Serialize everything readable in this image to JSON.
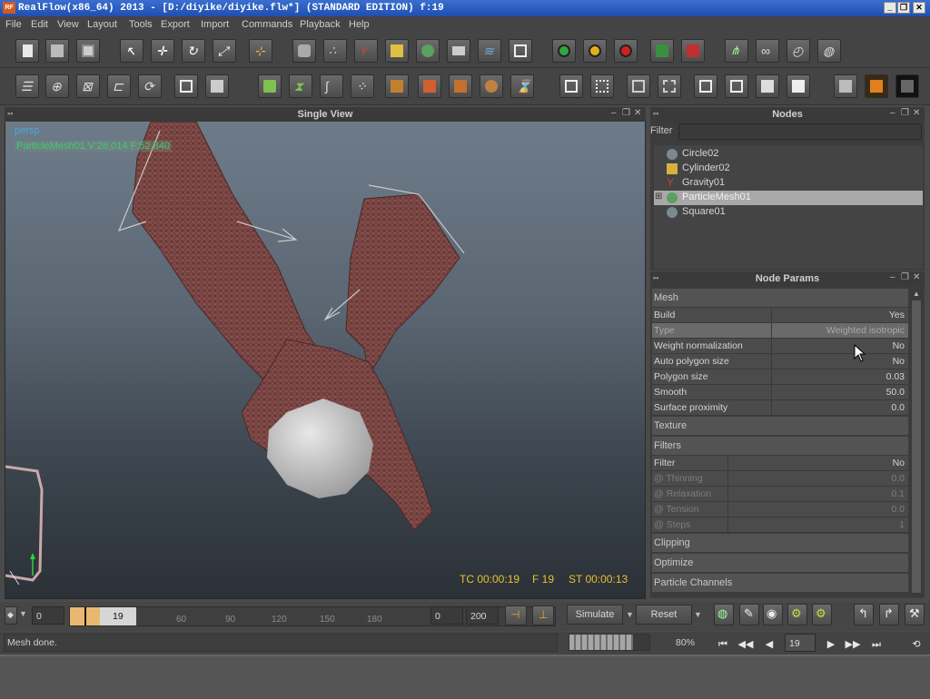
{
  "window": {
    "app_icon_text": "RF",
    "title": "RealFlow(x86_64) 2013 - [D:/diyike/diyike.flw*] (STANDARD EDITION) f:19",
    "controls": [
      "_",
      "❐",
      "✕"
    ]
  },
  "menu": [
    "File",
    "Edit",
    "View",
    "Layout",
    "Tools",
    "Export",
    "Import",
    "Commands",
    "Playback",
    "Help"
  ],
  "viewport": {
    "title": "Single View",
    "camera_label": "persp",
    "object_label": "ParticleMesh01 V:26,014 F:52,840",
    "timecode": "TC 00:00:19",
    "frame": "F 19",
    "sim_time": "ST 00:00:13"
  },
  "nodes_panel": {
    "title": "Nodes",
    "filter_label": "Filter",
    "filter_value": "",
    "items": [
      {
        "name": "Circle02",
        "icon": "emitter-icon",
        "selected": false
      },
      {
        "name": "Cylinder02",
        "icon": "object-icon",
        "selected": false
      },
      {
        "name": "Gravity01",
        "icon": "daemon-icon",
        "selected": false
      },
      {
        "name": "ParticleMesh01",
        "icon": "mesh-icon",
        "selected": true
      },
      {
        "name": "Square01",
        "icon": "emitter-icon",
        "selected": false
      }
    ]
  },
  "node_params": {
    "title": "Node Params",
    "sections": {
      "mesh": "Mesh",
      "texture": "Texture",
      "filters": "Filters",
      "clipping": "Clipping",
      "optimize": "Optimize",
      "particle_channels": "Particle Channels"
    },
    "mesh_rows": [
      {
        "key": "Build",
        "value": "Yes",
        "dim": false
      },
      {
        "key": "Type",
        "value": "Weighted isotropic",
        "dim": true
      },
      {
        "key": "Weight normalization",
        "value": "No",
        "dim": false
      },
      {
        "key": "Auto polygon size",
        "value": "No",
        "dim": false
      },
      {
        "key": "Polygon size",
        "value": "0.03",
        "dim": false
      },
      {
        "key": "Smooth",
        "value": "50.0",
        "dim": false
      },
      {
        "key": "Surface proximity",
        "value": "0.0",
        "dim": false
      }
    ],
    "filter_rows": [
      {
        "key": "Filter",
        "value": "No",
        "dim": false
      },
      {
        "key": "@ Thinning",
        "value": "0.0",
        "dim": true
      },
      {
        "key": "@ Relaxation",
        "value": "0.1",
        "dim": true
      },
      {
        "key": "@ Tension",
        "value": "0.0",
        "dim": true
      },
      {
        "key": "@ Steps",
        "value": "1",
        "dim": true
      }
    ]
  },
  "timeline": {
    "start": "0",
    "current": "19",
    "ticks": [
      "60",
      "90",
      "120",
      "150",
      "180"
    ],
    "range_start": "0",
    "range_end": "200",
    "simulate_label": "Simulate",
    "reset_label": "Reset",
    "frame_field": "19"
  },
  "status": {
    "message": "Mesh done.",
    "progress_text": "80%",
    "progress": 0.8
  }
}
